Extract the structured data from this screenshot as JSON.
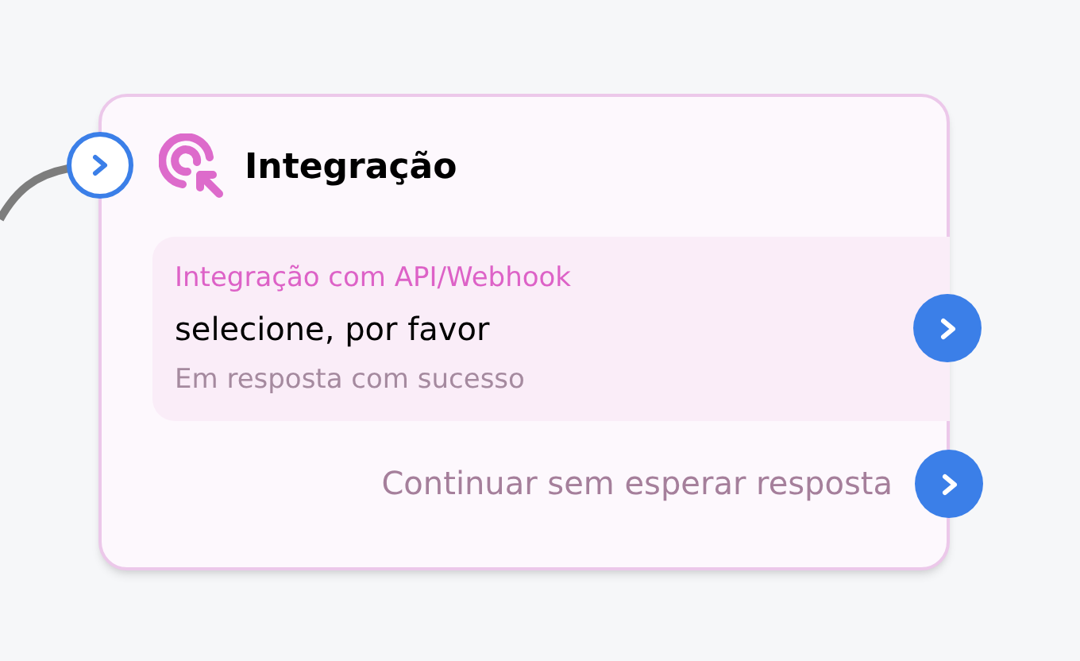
{
  "node": {
    "title": "Integração",
    "action": {
      "label": "Integração com API/Webhook",
      "value": "selecione, por favor",
      "outcome": "Em resposta com sucesso"
    },
    "fallback": "Continuar sem esperar resposta"
  }
}
